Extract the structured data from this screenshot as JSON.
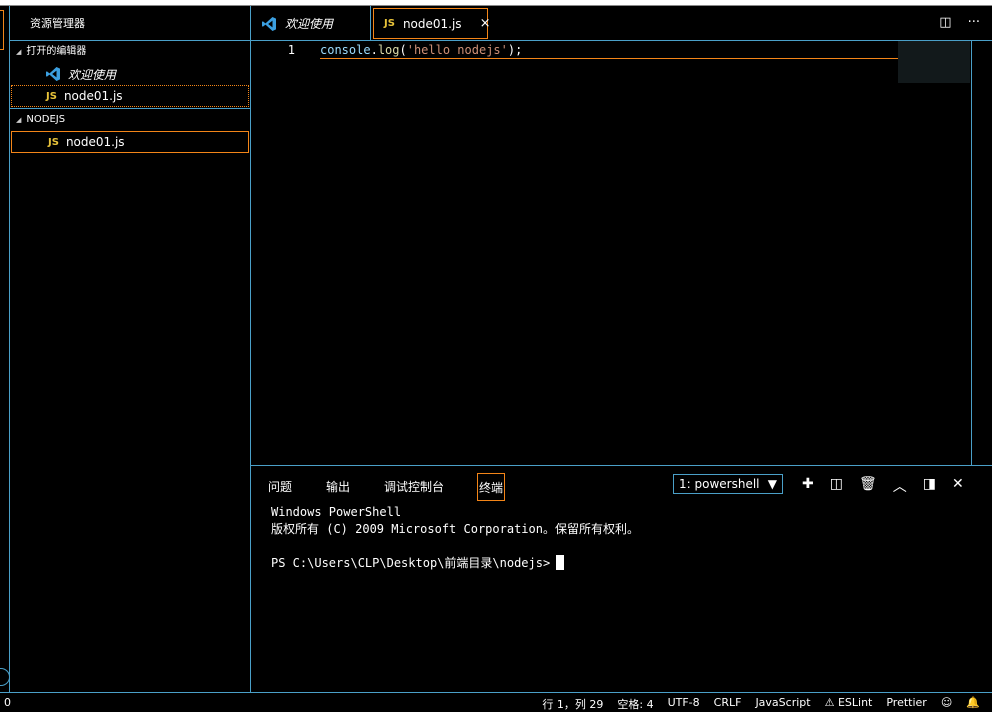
{
  "sidebar": {
    "title": "资源管理器",
    "open_editors_title": "打开的编辑器",
    "open_editors": [
      {
        "label": "欢迎使用",
        "icon": "vscode-icon"
      },
      {
        "label": "node01.js",
        "icon": "js-file-icon"
      }
    ],
    "folder_title": "NODEJS",
    "files": [
      {
        "label": "node01.js",
        "icon": "js-file-icon"
      }
    ],
    "js_badge": "JS"
  },
  "tabs": [
    {
      "label": "欢迎使用"
    },
    {
      "label": "node01.js",
      "badge": "JS",
      "close": "×"
    }
  ],
  "editor": {
    "line_number": "1",
    "tokens": {
      "obj": "console",
      "dot": ".",
      "fn": "log",
      "open": "(",
      "str": "'hello nodejs'",
      "close": ");"
    }
  },
  "panel": {
    "tabs": [
      "问题",
      "输出",
      "调试控制台",
      "终端"
    ],
    "active_tab": "终端",
    "terminal_select": "1: powershell",
    "terminal_lines": [
      "Windows PowerShell",
      "版权所有 (C) 2009 Microsoft Corporation。保留所有权利。",
      "",
      "PS C:\\Users\\CLP\\Desktop\\前端目录\\nodejs>"
    ]
  },
  "status": {
    "left": "0",
    "position": "行 1，列 29",
    "spaces": "空格: 4",
    "encoding": "UTF-8",
    "eol": "CRLF",
    "language": "JavaScript",
    "eslint": "ESLint",
    "prettier": "Prettier"
  },
  "colors": {
    "accent_border": "#f38518",
    "contrast_border": "#4a9fc8",
    "js_yellow": "#e8c33a"
  }
}
